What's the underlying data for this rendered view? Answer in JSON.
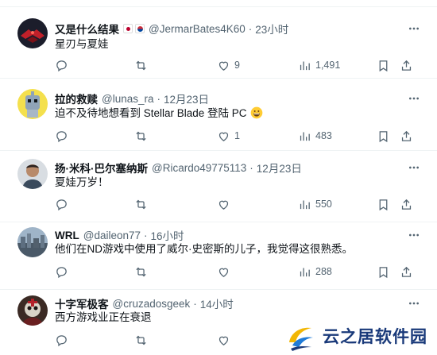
{
  "feed": {
    "tweets": [
      {
        "display_name": "又是什么结果",
        "flags": [
          "jp-flag",
          "kr-flag"
        ],
        "handle": "@JermarBates4K60",
        "time": "23小时",
        "text": "星刃与夏娃",
        "views": "1,491",
        "likes": "9",
        "avatar_icon": "dark-red-mech-avatar"
      },
      {
        "display_name": "拉的救赎",
        "handle": "@lunas_ra",
        "time": "12月23日",
        "text": "迫不及待地想看到 Stellar Blade 登陆 PC",
        "emoji": "grinning-face-emoji",
        "views": "483",
        "likes": "1",
        "avatar_icon": "yellow-robot-avatar"
      },
      {
        "display_name": "扬·米科·巴尔塞纳斯",
        "handle": "@Ricardo49775113",
        "time": "12月23日",
        "text": "夏娃万岁！",
        "views": "550",
        "avatar_icon": "person-photo-avatar"
      },
      {
        "display_name": "WRL",
        "handle": "@daileon77",
        "time": "16小时",
        "text": "他们在ND游戏中使用了威尔·史密斯的儿子，我觉得这很熟悉。",
        "views": "288",
        "avatar_icon": "city-skyline-avatar"
      },
      {
        "display_name": "十字军极客",
        "handle": "@cruzadosgeek",
        "time": "14小时",
        "text": "西方游戏业正在衰退",
        "avatar_icon": "crusader-skull-avatar"
      }
    ],
    "separator": "·"
  },
  "watermark": {
    "text": "云之居软件园",
    "icon": "yunzhiju-logo-icon"
  },
  "colors": {
    "text_primary": "#0f1419",
    "text_secondary": "#536471",
    "divider": "#eff3f4",
    "watermark": "#1a3a7a"
  }
}
